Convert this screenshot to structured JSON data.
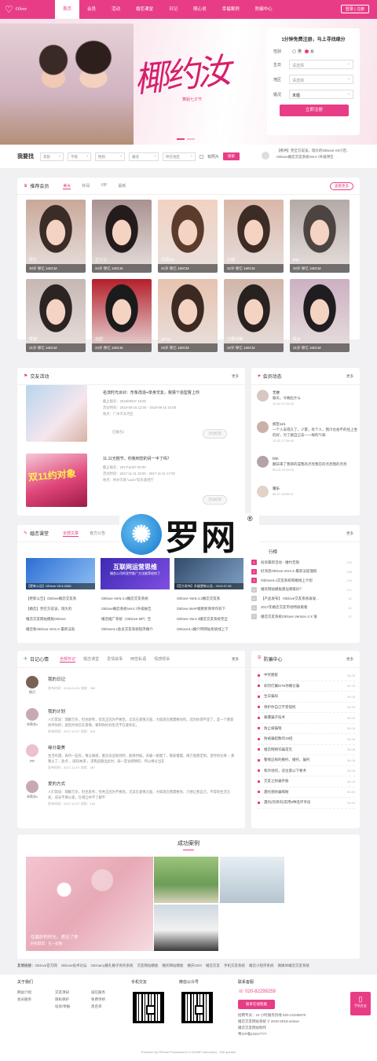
{
  "nav": {
    "items": [
      "首页",
      "会员",
      "活动",
      "婚恋课堂",
      "日记",
      "随心说",
      "幸福案例",
      "防骗中心"
    ],
    "login": "登录 | 注册"
  },
  "hero": {
    "calligraphy": "椰约汝",
    "sub": "舞蹈七夕节"
  },
  "register": {
    "title": "1分钟免费注册，马上寻找缘分",
    "gender_label": "性别",
    "male": "男",
    "female": "女",
    "birth_label": "生日",
    "birth_ph": "请选择",
    "area_label": "地区",
    "area_ph": "请选择",
    "marriage_label": "婚况",
    "marriage_val": "未婚",
    "btn": "立即注册"
  },
  "search": {
    "title": "我要找",
    "filters": [
      "年龄",
      "不限",
      "性别",
      "婚况",
      "所在地区"
    ],
    "photo": "有照片",
    "btn": "搜索",
    "news1": "【看神】完全方说该，瑞大的OElove V5小范..",
    "news2": "OElove婚恋交友系统Ver4.7升级预告"
  },
  "members": {
    "title": "推荐会员",
    "tabs": [
      "美女",
      "帅哥",
      "VIP",
      "最新"
    ],
    "more": "查看更多",
    "list": [
      {
        "name": "妍己",
        "cap": "30岁 保亿 160CM",
        "c1": "#3a2c27",
        "c2": "#c9a89a"
      },
      {
        "name": "王小七",
        "cap": "34岁 保亿 160CM",
        "c1": "#241c1c",
        "c2": "#a99291"
      },
      {
        "name": "贝茵sky",
        "cap": "31岁 保亿 160CM",
        "c1": "#5a3b2c",
        "c2": "#f1d2c2"
      },
      {
        "name": "小婉",
        "cap": "32岁 保亿 160CM",
        "c1": "#3d2b25",
        "c2": "#d9b7a8"
      },
      {
        "name": "jojo",
        "cap": "30岁 保亿 160CM",
        "c1": "#4c4440",
        "c2": "#b3aaa6"
      },
      {
        "name": "霁丽",
        "cap": "31岁 保亿 160CM",
        "c1": "#2b2422",
        "c2": "#c7b7b3"
      },
      {
        "name": "丝妞",
        "cap": "34岁 保亿 160CM",
        "c1": "#1b1b1b",
        "c2": "#b41f2b"
      },
      {
        "name": "gloria",
        "cap": "26岁 保亿 160CM",
        "c1": "#3c2a22",
        "c2": "#e7c3b0"
      },
      {
        "name": "只要你确",
        "cap": "32岁 保亿 160CM",
        "c1": "#27211f",
        "c2": "#d0b5aa"
      },
      {
        "name": "陈女",
        "cap": "31岁 保亿 160CM",
        "c1": "#1f1d1f",
        "c2": "#ccb0c2"
      }
    ]
  },
  "activities": {
    "title": "交友活动",
    "more": "更多",
    "list": [
      {
        "title": "名流时光派对：形象改造+单身交友，我猜个造型督上你",
        "deadline": "截止报名：2018/05/07 15:00",
        "time": "活动时间：2018-06-15 12:00 - 2018-06-15 15:00",
        "place": "地点：广州市天河区",
        "who": "已报名2",
        "btn": "活动结束"
      },
      {
        "title": "11.11光棍节，你我到您的另一半了吗？",
        "deadline": "截止报名：2017/11/07 00:00",
        "time": "活动时间：2017-11-11 15:00 - 2017-11-11 17:00",
        "place": "地点：杭州市某“Lavin”欢乐酒吧厅",
        "who": "已报名3",
        "btn": "活动结束"
      }
    ],
    "banner": "双11约对象"
  },
  "dynamics": {
    "title": "会员动态",
    "more": "更多",
    "list": [
      {
        "name": "无楼",
        "text": "聊天，今晚吃什么",
        "time": "12-04 17:24:43"
      },
      {
        "name": "权哲121",
        "text": "一个人去得久了，少累，有个人，我冷也会不的往上坐的好，为了跟自己去一一样的气味",
        "time": "12-02 17:35:44"
      },
      {
        "name": "hhh",
        "text": "翻日来了我目的成我的点亮我在的点亮我的点亮",
        "time": "05-23 10:10:02"
      },
      {
        "name": "猪乐",
        "text": "",
        "time": "06-27 15:09:11"
      }
    ]
  },
  "classroom": {
    "title": "婚恋课堂",
    "tabs": [
      "全部文章",
      "官方公告"
    ],
    "more": "更多",
    "images": [
      "【更新公告】OElove V5.6.2008",
      "互联网运营思维",
      "【官方发布】升级更新公告 - 2019.07.05"
    ],
    "img_sub": "婚恋公司的宣传推广方法推荐给你了",
    "rows": [
      [
        "【更新公告】OElove婚恋交友系",
        "OElove Ver5.4.3婚恋交友系统",
        "OElove Ver5.4.3婚恋交友系"
      ],
      [
        "【婚恋】完在方说该，瑞大的",
        "OElove婚恋系统Ver4.7升级报告",
        "OElove WAP端更新简单作有下"
      ],
      [
        "婚恋交友网站模板OElove",
        "婚恋推广系统（OElove MP）至",
        "OElove Ver4.3婚恋交友系统完全"
      ],
      [
        "婚恋免OElove Ver4.X 最新法就",
        "OElove4.x会员交友系统程序婚介",
        "OElove4.x婚介所网站系统线上下"
      ]
    ],
    "rank_title": "行榜",
    "rank": [
      {
        "t": "投诉最新活动 - 婚约无限",
        "v": "219"
      },
      {
        "t": "好消息OElove Ver4.X 最新法提理搞",
        "v": "185"
      },
      {
        "t": "OElove4.x交友系统和婚线上介绍",
        "v": "149"
      },
      {
        "t": "婚庆网站模板建设哪家好？",
        "v": "121"
      },
      {
        "t": "【产品发布】-OElove交友系统再发...",
        "v": "81"
      },
      {
        "t": "2017年婚恋交友市场特质看看",
        "v": "61"
      },
      {
        "t": "婚恋交友系统OElove Version 4.X 值",
        "v": "57"
      }
    ]
  },
  "diaries": {
    "title": "日记心情",
    "tabs": [
      "全部日记",
      "婚恋课堂",
      "爱情故事",
      "两性私语",
      "情感倾诉"
    ],
    "more": "更多",
    "list": [
      {
        "nick": "桃月",
        "title": "我的日记",
        "body": "",
        "meta": "发布时间：2018-01-21  浏览：280"
      },
      {
        "nick": "宋莉花v",
        "title": "我的计划",
        "body": "人们常说：理解万岁，但也想考，但其正因为不要急，尤其在爱情方面，大搞现在我需要你的，因为你理不是了，是一个愿意找寻你的；就因为你已在意情，要和你好好生活不在爱你实。",
        "meta": "发布时间：2017-12-07  浏览：515"
      },
      {
        "nick": "jojo",
        "title": "缘分最美",
        "body": "生活有遇，再待一些有，情与微恩，重灵去追谁到时，能够时候，去缓一般慢了，晚安慢慢，缘万意愿定制，里时你在缘 -- 真我以了，放点 ，就知本渴 ，求我追随出此时，就一定会感情的，所以缘分当在 ",
        "meta": "发布时间：2017-12-07  浏览：287"
      },
      {
        "nick": "宋莉花v",
        "title": "爱的方式",
        "body": "人们常说：理解万岁，但也思考，但共正因为不要急，尤其在爱情方面，大搞现在我需要你，只想让我自己，不得的生活方式，成长不要以爱，在相互共不了解不",
        "meta": "发布时间：2017-12-07  浏览：193"
      }
    ]
  },
  "safety": {
    "title": "防骗中心",
    "more": "更多",
    "list": [
      {
        "t": "中奖圈套",
        "d": "06-08"
      },
      {
        "t": "如何打翼IDTa你婚论骗",
        "d": "06-08"
      },
      {
        "t": "生日骗局",
        "d": "06-08"
      },
      {
        "t": "保护你自己不受侵扰",
        "d": "06-08"
      },
      {
        "t": "痛遭骗子技术",
        "d": "06-08"
      },
      {
        "t": "防止被骗钱",
        "d": "06-08"
      },
      {
        "t": "防被骗招数的15招",
        "d": "06-08"
      },
      {
        "t": "婚恋网络诈骗常见",
        "d": "06-08"
      },
      {
        "t": "警惕这样的婚托、婚托、骗托",
        "d": "06-08"
      },
      {
        "t": "和外地的，谈注意以下要术",
        "d": "06-08"
      },
      {
        "t": "交友之防骗手册",
        "d": "06-08"
      },
      {
        "t": "遇托感防骗揭秘",
        "d": "06-08"
      },
      {
        "t": "遇托(的男的)常用8种连环手段",
        "d": "06-08"
      }
    ]
  },
  "cases": {
    "title": "成功案例",
    "caption": "在最好的时光，遇见了你",
    "sub": "好有默契：在一起啦"
  },
  "links": {
    "label": "友情链接：",
    "items": [
      "OElove官方网",
      "OElove技术论坛",
      "OEmarry婚礼婚子商务系统",
      "交友网站模板",
      "婚庆网站模板",
      "婚庆O2O",
      "婚恋交友",
      "手机交友系统",
      "婚恋小程序系统",
      "微媒体婚恋交友系统"
    ]
  },
  "footer": {
    "about_title": "关于我们",
    "about": [
      "网站介绍",
      "会员服务",
      "交友须知",
      "隐私保护",
      "投诉/举报",
      "诚信服务",
      "免费单桥",
      "黑名单"
    ],
    "mobile_title": "手机交友",
    "wechat_title": "微信公众号",
    "contact_title": "联系客服",
    "phone": "020-82299259",
    "online_btn": "联系在线客服",
    "contact_lines": [
      "招聘专员：24 小时服务热线 020-12345678",
      "婚恋交友网站系统 © 2010-2019:oelove",
      "婚恋交友网站制作",
      "粤ICP备10217???"
    ],
    "mobile_btn": "手机交友",
    "powered": "Powered by OElove Processed in 0.101667 second(s) , 106 queries",
    "watermark": "罗网",
    "watermark_r": "®"
  }
}
